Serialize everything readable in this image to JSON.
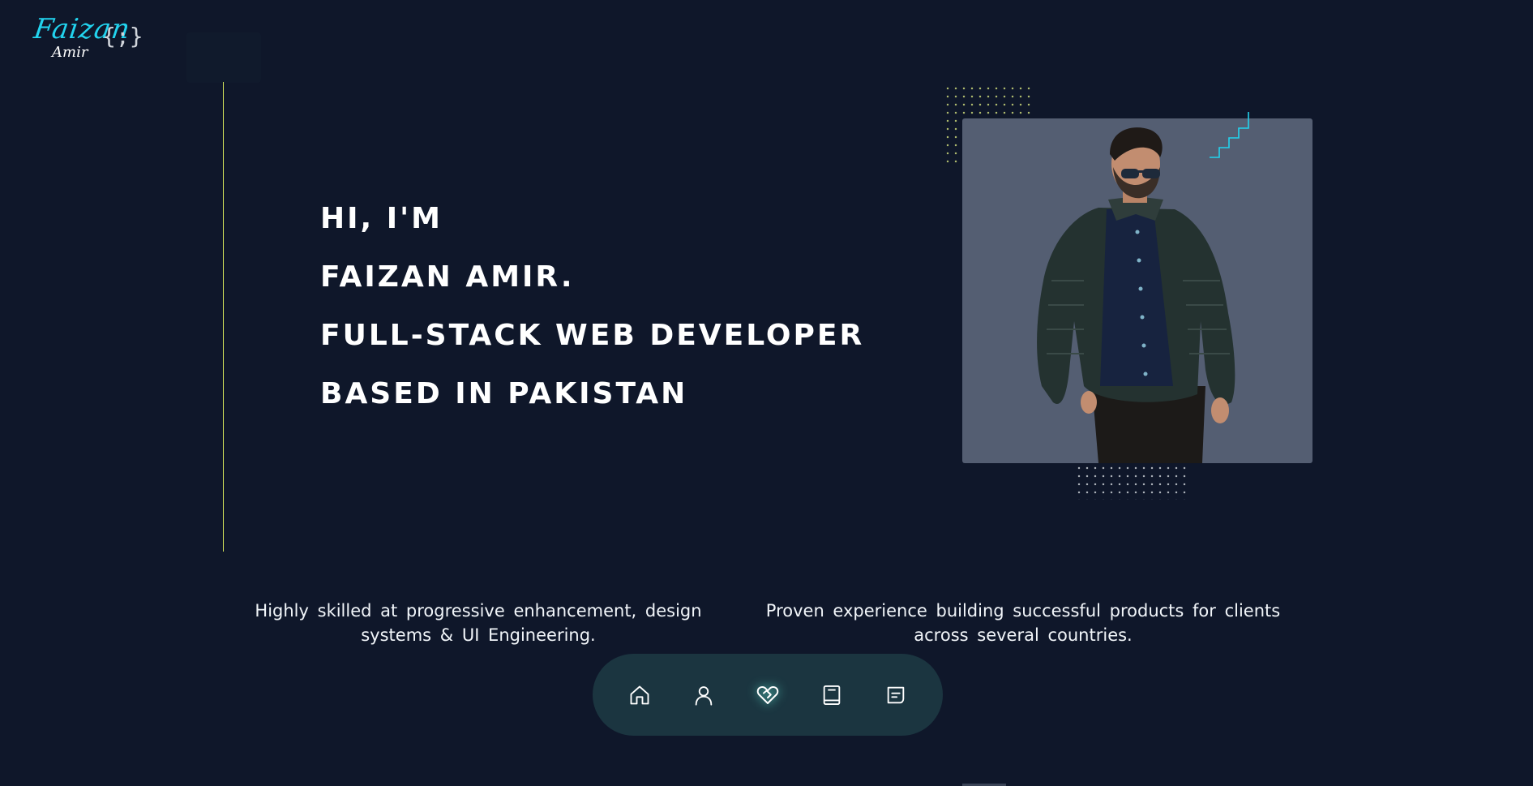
{
  "logo": {
    "main": "Faizan",
    "sub": "Amir",
    "braces": "{;}",
    "accent_color": "#22d3ee"
  },
  "hero": {
    "lines": [
      "HI, I'M",
      "FAIZAN AMIR.",
      "FULL-STACK WEB DEVELOPER",
      "BASED IN PAKISTAN"
    ],
    "accent_line_color": "#d4e45a"
  },
  "descriptions": {
    "left": "Highly skilled at progressive enhancement, design systems & UI Engineering.",
    "right": "Proven experience building successful products for clients across several countries."
  },
  "nav": {
    "items": [
      {
        "icon": "home-icon",
        "active": false
      },
      {
        "icon": "user-icon",
        "active": false
      },
      {
        "icon": "handshake-icon",
        "active": true
      },
      {
        "icon": "book-icon",
        "active": false
      },
      {
        "icon": "message-icon",
        "active": false
      }
    ],
    "background": "#1b3540"
  },
  "colors": {
    "page_background": "#0f172a",
    "photo_background": "#545e72",
    "steps_color": "#22d3ee"
  }
}
